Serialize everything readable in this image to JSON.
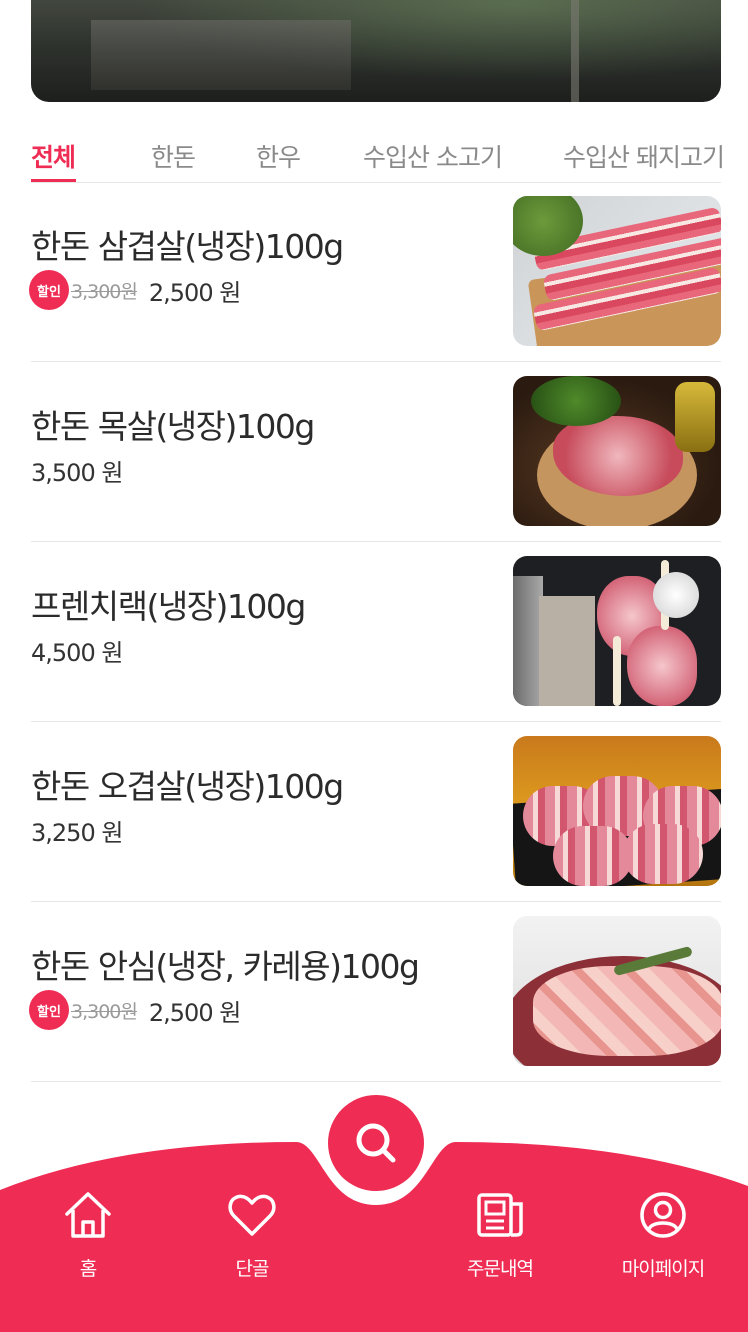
{
  "tabs": [
    {
      "label": "전체",
      "active": true
    },
    {
      "label": "한돈",
      "active": false
    },
    {
      "label": "한우",
      "active": false
    },
    {
      "label": "수입산 소고기",
      "active": false
    },
    {
      "label": "수입산 돼지고기",
      "active": false
    }
  ],
  "products": [
    {
      "name": "한돈 삼겹살(냉장)100g",
      "sale_badge": "할인",
      "original_price": "3,300원",
      "price": "2,500 원"
    },
    {
      "name": "한돈 목살(냉장)100g",
      "price": "3,500 원"
    },
    {
      "name": "프렌치랙(냉장)100g",
      "price": "4,500 원"
    },
    {
      "name": "한돈 오겹살(냉장)100g",
      "price": "3,250 원"
    },
    {
      "name": "한돈 안심(냉장, 카레용)100g",
      "sale_badge": "할인",
      "original_price": "3,300원",
      "price": "2,500 원"
    }
  ],
  "bottom_nav": {
    "home": "홈",
    "favorites": "단골",
    "orders": "주문내역",
    "mypage": "마이페이지",
    "search_icon": "search-icon"
  },
  "colors": {
    "accent": "#ef2c54",
    "text": "#2b2b2b",
    "muted": "#8a8a8a"
  }
}
